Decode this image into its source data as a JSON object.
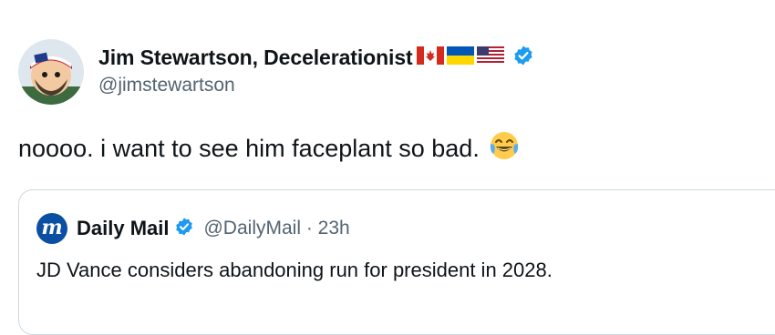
{
  "author": {
    "display_name": "Jim Stewartson, Decelerationist",
    "handle": "@jimstewartson",
    "flags": [
      "canada-flag-icon",
      "ukraine-flag-icon",
      "usa-flag-icon"
    ],
    "verified_icon": "verified-badge-icon"
  },
  "tweet": {
    "text": "noooo. i want to see him faceplant so bad.",
    "emoji": "face-with-tears-of-joy-icon"
  },
  "quote": {
    "logo_letter": "m",
    "name": "Daily Mail",
    "meta": "@DailyMail · 23h",
    "text": "JD Vance considers abandoning run for president in 2028."
  },
  "colors": {
    "verified": "#1d9bf0",
    "secondary_text": "#536471",
    "border": "#cfd9de",
    "dailymail_blue": "#0b4fa3"
  }
}
